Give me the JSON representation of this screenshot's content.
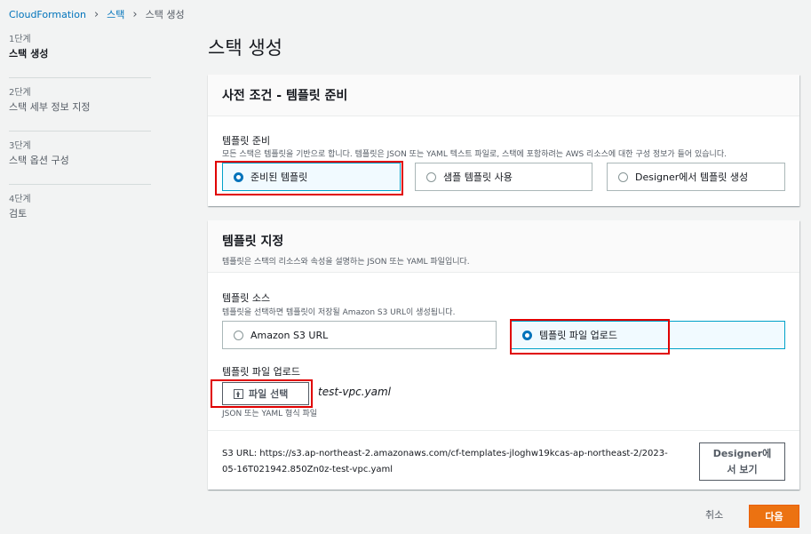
{
  "breadcrumb": {
    "items": [
      "CloudFormation",
      "스택",
      "스택 생성"
    ]
  },
  "steps": [
    {
      "num": "1단계",
      "label": "스택 생성"
    },
    {
      "num": "2단계",
      "label": "스택 세부 정보 지정"
    },
    {
      "num": "3단계",
      "label": "스택 옵션 구성"
    },
    {
      "num": "4단계",
      "label": "검토"
    }
  ],
  "page_title": "스택 생성",
  "prereq": {
    "title": "사전 조건 - 템플릿 준비",
    "field_label": "템플릿 준비",
    "field_desc": "모든 스택은 템플릿을 기반으로 합니다. 템플릿은 JSON 또는 YAML 텍스트 파일로, 스택에 포함하려는 AWS 리소스에 대한 구성 정보가 들어 있습니다.",
    "options": [
      "준비된 템플릿",
      "샘플 템플릿 사용",
      "Designer에서 템플릿 생성"
    ],
    "selected": 0
  },
  "template": {
    "title": "템플릿 지정",
    "desc": "템플릿은 스택의 리소스와 속성을 설명하는 JSON 또는 YAML 파일입니다.",
    "source_label": "템플릿 소스",
    "source_desc": "템플릿을 선택하면 템플릿이 저장될 Amazon S3 URL이 생성됩니다.",
    "source_options": [
      "Amazon S3 URL",
      "템플릿 파일 업로드"
    ],
    "source_selected": 1,
    "upload_label": "템플릿 파일 업로드",
    "choose_file": "파일 선택",
    "file_name": "test-vpc.yaml",
    "file_hint": "JSON 또는 YAML 형식 파일",
    "s3_url_line1": "S3 URL:   https://s3.ap-northeast-2.amazonaws.com/cf-templates-jloghw19kcas-ap-northeast-2/2023-",
    "s3_url_line2": "05-16T021942.850Zn0z-test-vpc.yaml",
    "designer_line1": "Designer에",
    "designer_line2": "서 보기"
  },
  "footer": {
    "cancel": "취소",
    "next": "다음"
  },
  "colors": {
    "accent": "#0073bb",
    "primary_button": "#ec7211",
    "highlight": "#e00000"
  }
}
